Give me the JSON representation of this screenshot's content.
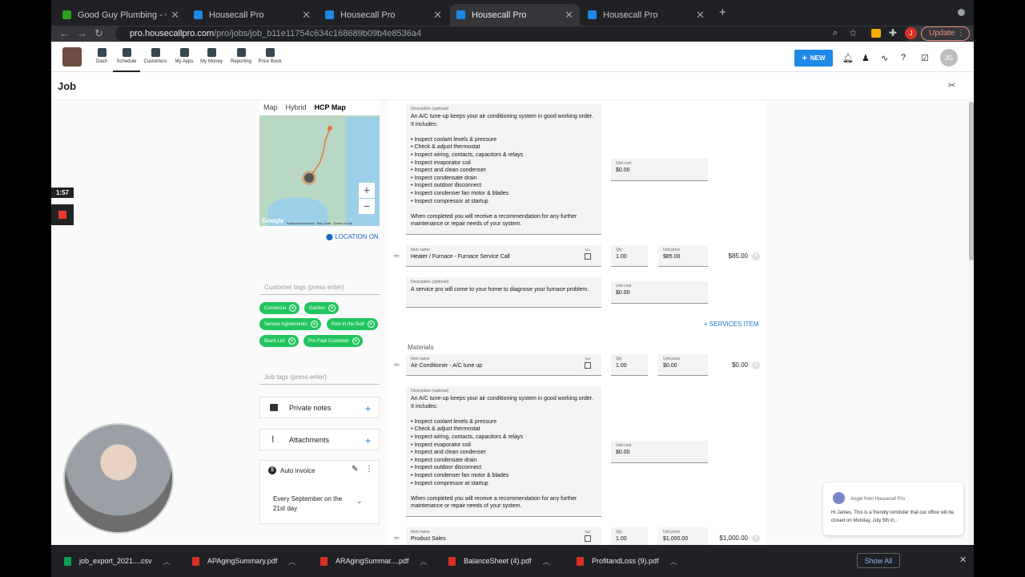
{
  "browser": {
    "tabs": [
      {
        "title": "Good Guy Plumbing - QuickBo",
        "active": false
      },
      {
        "title": "Housecall Pro",
        "active": false
      },
      {
        "title": "Housecall Pro",
        "active": false
      },
      {
        "title": "Housecall Pro",
        "active": true
      },
      {
        "title": "Housecall Pro",
        "active": false
      }
    ],
    "url_host": "pro.housecallpro.com",
    "url_path": "/pro/jobs/job_b11e11754c634c168689b09b4e8536a4",
    "update_label": "Update",
    "profile_initial": "J"
  },
  "topnav": {
    "items": [
      "Dash",
      "Schedule",
      "Customers",
      "My Apps",
      "My Money",
      "Reporting",
      "Price Book"
    ],
    "active": "Schedule",
    "new_label": "NEW",
    "avatar_initials": "JG"
  },
  "page": {
    "title": "Job"
  },
  "map": {
    "tabs": [
      "Map",
      "Hybrid",
      "HCP Map"
    ],
    "selected_tab": "HCP Map",
    "zoom_in": "+",
    "zoom_out": "−",
    "brand": "Google",
    "legal": [
      "Keyboard shortcuts",
      "Map Data",
      "Terms of Use"
    ],
    "location_label": "LOCATION ON"
  },
  "customer_tags": {
    "placeholder": "Customer tags (press enter)",
    "tags": [
      "Comercial",
      "Garden",
      "Service Agreements",
      "Pain in the Butt",
      "Black List",
      "Pre Paid Customer"
    ]
  },
  "job_tags": {
    "placeholder": "Job tags (press enter)"
  },
  "private_notes_label": "Private notes",
  "attachments_label": "Attachments",
  "auto_invoice": {
    "title": "Auto invoice",
    "schedule": "Every September on the 21st day"
  },
  "line_items": {
    "desc_label": "Description (optional)",
    "item_name_label": "Item name",
    "qty_label": "Qty",
    "unit_price_label": "Unit price",
    "unit_cost_label": "Unit cost",
    "tax_label": "TAX",
    "ac_description": "An A/C tune-up keeps your air conditioning system in good working order. It includes:\n\n• Inspect coolant levels & pressure\n• Check & adjust thermostat\n• Inspect wiring, contacts, capacitors & relays\n• Inspect evaporator coil\n• Inspect and clean condenser\n• Inspect condensate drain\n• Inspect outdoor disconnect\n• Inspect condenser fan motor & blades\n• Inspect compressor at startup\n\nWhen completed you will receive a recommendation for any further maintenance or repair needs of your system.",
    "service_cost_top": "$0.00",
    "furnace": {
      "name": "Heater / Furnace - Furnace Service Call",
      "qty": "1.00",
      "unit_price": "$85.00",
      "total": "$85.00",
      "description": "A service pro will come to your home to diagnose your furnace problem.",
      "unit_cost": "$0.00"
    },
    "add_services_label": "+ SERVICES ITEM",
    "materials_heading": "Materials",
    "ac_material": {
      "name": "Air Conditioner - A/C tune up",
      "qty": "1.00",
      "unit_price": "$0.00",
      "total": "$0.00",
      "unit_cost": "$0.00"
    },
    "product_sales": {
      "name": "Product Sales",
      "qty": "1.00",
      "unit_price": "$1,000.00",
      "total": "$1,000.00"
    }
  },
  "chat": {
    "sender": "Angel",
    "from_suffix": "from Housecall Pro",
    "message": "Hi James, This is a friendly reminder that our office will be closed on Monday, July 5th in..."
  },
  "recorder": {
    "time": "1:57"
  },
  "downloads": {
    "files": [
      {
        "name": "job_export_2021....csv",
        "kind": "csv"
      },
      {
        "name": "APAgingSummary.pdf",
        "kind": "pdf"
      },
      {
        "name": "ARAgingSummar....pdf",
        "kind": "pdf"
      },
      {
        "name": "BalanceSheet (4).pdf",
        "kind": "pdf"
      },
      {
        "name": "ProfitandLoss (9).pdf",
        "kind": "pdf"
      }
    ],
    "show_all_label": "Show All"
  },
  "colors": {
    "accent": "#1e88e5",
    "tag_green": "#22c55e",
    "link_blue": "#1976d2",
    "chrome_dark": "#202124"
  }
}
